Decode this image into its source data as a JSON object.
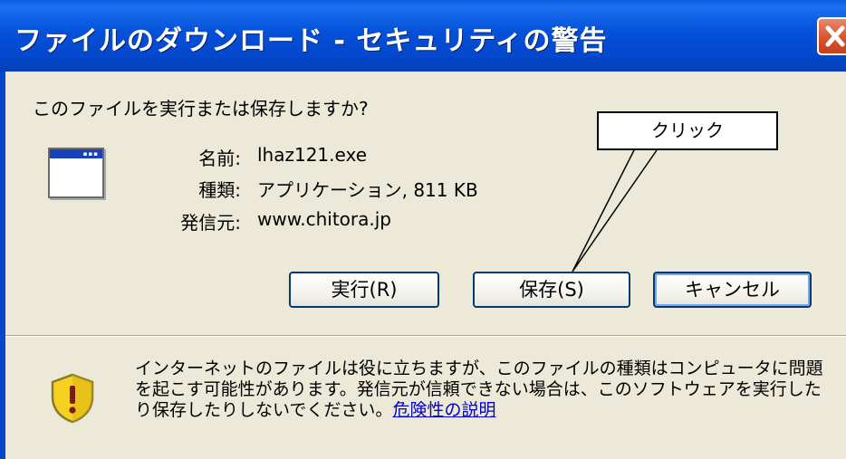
{
  "window": {
    "title": "ファイルのダウンロード - セキュリティの警告",
    "close_glyph": "✕"
  },
  "dialog": {
    "question": "このファイルを実行または保存しますか?",
    "file_icon": "application-window-icon",
    "name_label": "名前:",
    "name_value": "lhaz121.exe",
    "type_label": "種類:",
    "type_value": "アプリケーション, 811 KB",
    "from_label": "発信元:",
    "from_value": "www.chitora.jp"
  },
  "buttons": {
    "run": "実行(R)",
    "save": "保存(S)",
    "cancel": "キャンセル"
  },
  "annotation": {
    "callout_text": "クリック"
  },
  "warning": {
    "icon": "shield-warning-icon",
    "text": "インターネットのファイルは役に立ちますが、このファイルの種類はコンピュータに問題を起こす可能性があります。発信元が信頼できない場合は、このソフトウェアを実行したり保存したりしないでください。",
    "link": "危険性の説明"
  },
  "colors": {
    "titlebar": "#0550d8",
    "body": "#ece9d8",
    "button_border": "#003c74",
    "close": "#d8542f",
    "link": "#0000cc",
    "shield_yellow": "#f5d21f"
  }
}
